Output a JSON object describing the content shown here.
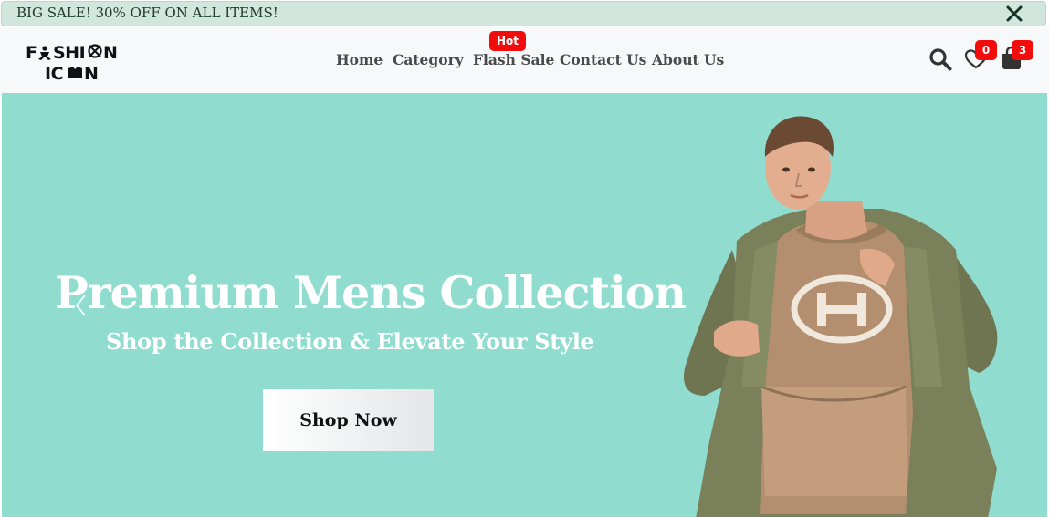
{
  "promo": {
    "text": "BIG SALE! 30% OFF ON ALL ITEMS!",
    "close_icon": "close-icon"
  },
  "header": {
    "logo": {
      "line1": "FASHION",
      "line2": "ICON"
    },
    "nav": {
      "home": "Home",
      "category": "Category",
      "flash_sale": "Flash Sale",
      "contact": "Contact Us",
      "about": "About Us"
    },
    "hot_badge": "Hot",
    "icons": {
      "search": "search-icon",
      "wishlist": "heart-icon",
      "cart": "shopping-bag-icon"
    },
    "wishlist_count": "0",
    "cart_count": "3"
  },
  "hero": {
    "title": "Premium Mens Collection",
    "subtitle": "Shop the Collection & Elevate Your Style",
    "cta": "Shop Now",
    "prev_icon": "chevron-left-icon",
    "next_icon": "chevron-right-icon"
  },
  "colors": {
    "promo_bg": "#d1e7dd",
    "nav_bg": "#f7f8fa",
    "hero_bg": "#90ddd0",
    "badge_red": "#f20c0c"
  }
}
